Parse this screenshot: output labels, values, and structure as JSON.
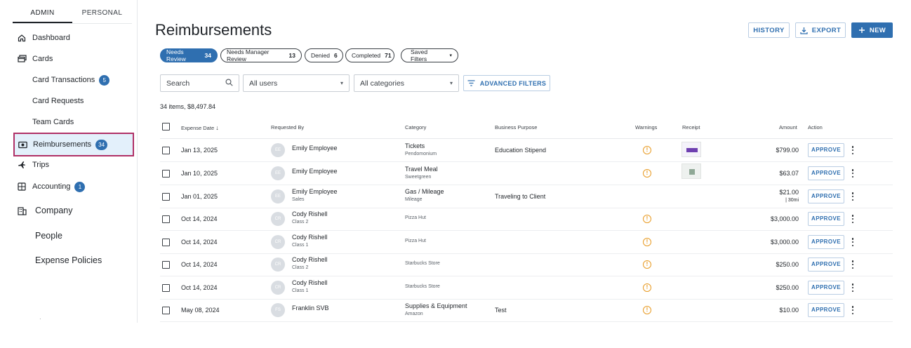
{
  "sidebar": {
    "tabs": [
      "ADMIN",
      "PERSONAL"
    ],
    "items": [
      {
        "label": "Dashboard",
        "icon": "home-icon"
      },
      {
        "label": "Cards",
        "icon": "cards-icon"
      },
      {
        "label": "Card Transactions",
        "badge": "5"
      },
      {
        "label": "Card Requests"
      },
      {
        "label": "Team Cards"
      },
      {
        "label": "Reimbursements",
        "icon": "cash-icon",
        "badge": "34"
      },
      {
        "label": "Trips",
        "icon": "plane-icon"
      },
      {
        "label": "Accounting",
        "icon": "accounting-icon",
        "badge": "1"
      },
      {
        "label": "Company",
        "icon": "building-icon"
      },
      {
        "label": "People"
      },
      {
        "label": "Expense Policies"
      }
    ]
  },
  "header": {
    "title": "Reimbursements",
    "history_label": "HISTORY",
    "export_label": "EXPORT",
    "new_label": "NEW"
  },
  "chips": [
    {
      "label": "Needs Review",
      "count": "34"
    },
    {
      "label": "Needs Manager Review",
      "count": "13"
    },
    {
      "label": "Denied",
      "count": "6"
    },
    {
      "label": "Completed",
      "count": "71"
    },
    {
      "label": "Saved Filters"
    }
  ],
  "filters": {
    "search_placeholder": "Search",
    "users": "All users",
    "categories": "All categories",
    "advanced": "ADVANCED FILTERS"
  },
  "summary": "34 items, $8,497.84",
  "columns": {
    "date": "Expense Date",
    "requested_by": "Requested By",
    "category": "Category",
    "purpose": "Business Purpose",
    "warnings": "Warnings",
    "receipt": "Receipt",
    "amount": "Amount",
    "action": "Action"
  },
  "rows": [
    {
      "date": "Jan 13, 2025",
      "initials": "EE",
      "name": "Emily Employee",
      "name_sub": "",
      "category": "Tickets",
      "category_sub": "Pendomonium",
      "purpose": "Education Stipend",
      "amount": "$799.00",
      "amount_sub": "",
      "action": "APPROVE"
    },
    {
      "date": "Jan 10, 2025",
      "initials": "EE",
      "name": "Emily Employee",
      "name_sub": "",
      "category": "Travel Meal",
      "category_sub": "Sweetgreen",
      "purpose": "",
      "amount": "$63.07",
      "amount_sub": "",
      "action": "APPROVE"
    },
    {
      "date": "Jan 01, 2025",
      "initials": "EE",
      "name": "Emily Employee",
      "name_sub": "Sales",
      "category": "Gas / Mileage",
      "category_sub": "Mileage",
      "purpose": "Traveling to Client",
      "amount": "$21.00",
      "amount_sub": "|   30mi",
      "action": "APPROVE"
    },
    {
      "date": "Oct 14, 2024",
      "initials": "CR",
      "name": "Cody Rishell",
      "name_sub": "Class 2",
      "category": "",
      "category_sub": "Pizza Hut",
      "purpose": "",
      "amount": "$3,000.00",
      "amount_sub": "",
      "action": "APPROVE"
    },
    {
      "date": "Oct 14, 2024",
      "initials": "CR",
      "name": "Cody Rishell",
      "name_sub": "Class 1",
      "category": "",
      "category_sub": "Pizza Hut",
      "purpose": "",
      "amount": "$3,000.00",
      "amount_sub": "",
      "action": "APPROVE"
    },
    {
      "date": "Oct 14, 2024",
      "initials": "CR",
      "name": "Cody Rishell",
      "name_sub": "Class 2",
      "category": "",
      "category_sub": "Starbucks Store",
      "purpose": "",
      "amount": "$250.00",
      "amount_sub": "",
      "action": "APPROVE"
    },
    {
      "date": "Oct 14, 2024",
      "initials": "CR",
      "name": "Cody Rishell",
      "name_sub": "Class 1",
      "category": "",
      "category_sub": "Starbucks Store",
      "purpose": "",
      "amount": "$250.00",
      "amount_sub": "",
      "action": "APPROVE"
    },
    {
      "date": "May 08, 2024",
      "initials": "FS",
      "name": "Franklin SVB",
      "name_sub": "",
      "category": "Supplies & Equipment",
      "category_sub": "Amazon",
      "purpose": "Test",
      "amount": "$10.00",
      "amount_sub": "",
      "action": "APPROVE"
    }
  ],
  "colors": {
    "accent": "#2f6fb0",
    "warning": "#e89a22",
    "highlight_border": "#b03066"
  }
}
